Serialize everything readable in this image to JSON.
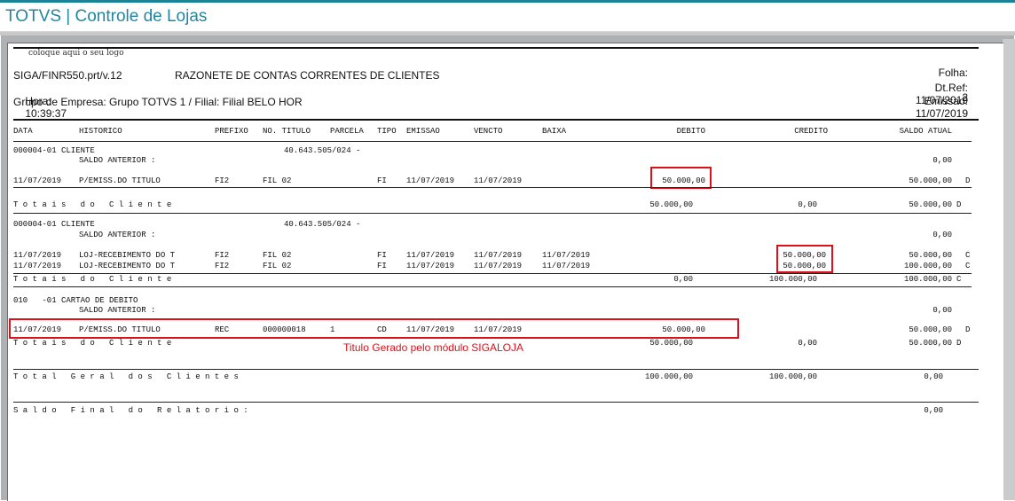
{
  "app": {
    "title": "TOTVS | Controle de Lojas"
  },
  "logo": {
    "text": "coloque aqui o seu logo"
  },
  "report": {
    "program": "SIGA/FINR550.prt/v.12",
    "title": "RAZONETE DE CONTAS CORRENTES DE CLIENTES",
    "hora_label": "Hora:",
    "hora_value": "10:39:37",
    "grupo": "Grupo de Empresa: Grupo TOTVS 1 / Filial: Filial BELO HOR",
    "folha_label": "Folha:",
    "folha_value": "2",
    "dtref_label": "Dt.Ref:",
    "dtref_value": "11/07/2019",
    "emissao_label": "Emissao:",
    "emissao_value": "11/07/2019"
  },
  "columns": {
    "data": "DATA",
    "historico": "HISTORICO",
    "prefixo": "PREFIXO",
    "no_titulo": "NO. TITULO",
    "parcela": "PARCELA",
    "tipo": "TIPO",
    "emissao": "EMISSAO",
    "vencto": "VENCTO",
    "baixa": "BAIXA",
    "debito": "DEBITO",
    "credito": "CREDITO",
    "saldo_atual": "SALDO ATUAL"
  },
  "block1": {
    "cliente": "000004-01 CLIENTE",
    "cnpj": "40.643.505/024 -",
    "saldo_anterior_label": "SALDO ANTERIOR :",
    "saldo_anterior_value": "0,00",
    "row": {
      "data": "11/07/2019",
      "historico": "P/EMISS.DO TITULO",
      "prefixo": "FI2",
      "titulo": "FIL 02",
      "tipo": "FI",
      "emissao": "11/07/2019",
      "vencto": "11/07/2019",
      "debito": "50.000,00",
      "saldo": "50.000,00",
      "dc": "D"
    },
    "totais_label": "T o t a i s   d o   C l i e n t e",
    "totais_debito": "50.000,00",
    "totais_credito": "0,00",
    "totais_saldo": "50.000,00",
    "totais_dc": "D"
  },
  "block2": {
    "cliente": "000004-01 CLIENTE",
    "cnpj": "40.643.505/024 -",
    "saldo_anterior_label": "SALDO ANTERIOR :",
    "saldo_anterior_value": "0,00",
    "rows": [
      {
        "data": "11/07/2019",
        "historico": "LOJ-RECEBIMENTO DO T",
        "prefixo": "FI2",
        "titulo": "FIL 02",
        "tipo": "FI",
        "emissao": "11/07/2019",
        "vencto": "11/07/2019",
        "baixa": "11/07/2019",
        "credito": "50.000,00",
        "saldo": "50.000,00",
        "dc": "C"
      },
      {
        "data": "11/07/2019",
        "historico": "LOJ-RECEBIMENTO DO T",
        "prefixo": "FI2",
        "titulo": "FIL 02",
        "tipo": "FI",
        "emissao": "11/07/2019",
        "vencto": "11/07/2019",
        "baixa": "11/07/2019",
        "credito": "50.000,00",
        "saldo": "100.000,00",
        "dc": "C"
      }
    ],
    "totais_label": "T o t a i s   d o   C l i e n t e",
    "totais_debito": "0,00",
    "totais_credito": "100.000,00",
    "totais_saldo": "100.000,00",
    "totais_dc": "C"
  },
  "block3": {
    "cliente": "010   -01 CARTAO DE DEBITO",
    "saldo_anterior_label": "SALDO ANTERIOR :",
    "saldo_anterior_value": "0,00",
    "row": {
      "data": "11/07/2019",
      "historico": "P/EMISS.DO TITULO",
      "prefixo": "REC",
      "titulo": "000000018",
      "parcela": "1",
      "tipo": "CD",
      "emissao": "11/07/2019",
      "vencto": "11/07/2019",
      "debito": "50.000,00",
      "saldo": "50.000,00",
      "dc": "D"
    },
    "totais_label": "T o t a i s   d o   C l i e n t e",
    "totais_debito": "50.000,00",
    "totais_credito": "0,00",
    "totais_saldo": "50.000,00",
    "totais_dc": "D"
  },
  "annotation": "Titulo Gerado pelo módulo SIGALOJA",
  "total_geral": {
    "label": "T o t a l   G e r a l   d o s   C l i e n t e s",
    "debito": "100.000,00",
    "credito": "100.000,00",
    "saldo": "0,00"
  },
  "saldo_final": {
    "label": "S a l d o   F i n a l   d o   R e l a t o r i o :",
    "value": "0,00"
  },
  "colors": {
    "accent": "#2286a0",
    "highlight": "#e0101a"
  }
}
